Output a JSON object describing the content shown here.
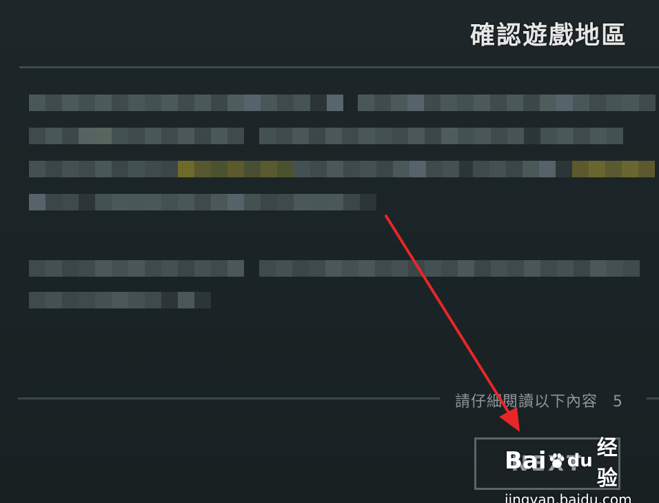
{
  "dialog": {
    "title": "確認遊戲地區",
    "notice_text": "請仔細閱讀以下內容",
    "countdown": "5",
    "next_button_label": "NEXT"
  },
  "body_text": "(pixelated / blurred paragraph text)",
  "watermark": {
    "brand_left": "Bai",
    "brand_du": "du",
    "brand_cn": "经验",
    "url": "jingyan.baidu.com"
  },
  "colors": {
    "background": "#1b2527",
    "divider": "#3e4b4d",
    "highlight": "#6e6a2a",
    "arrow": "#e8262a"
  }
}
